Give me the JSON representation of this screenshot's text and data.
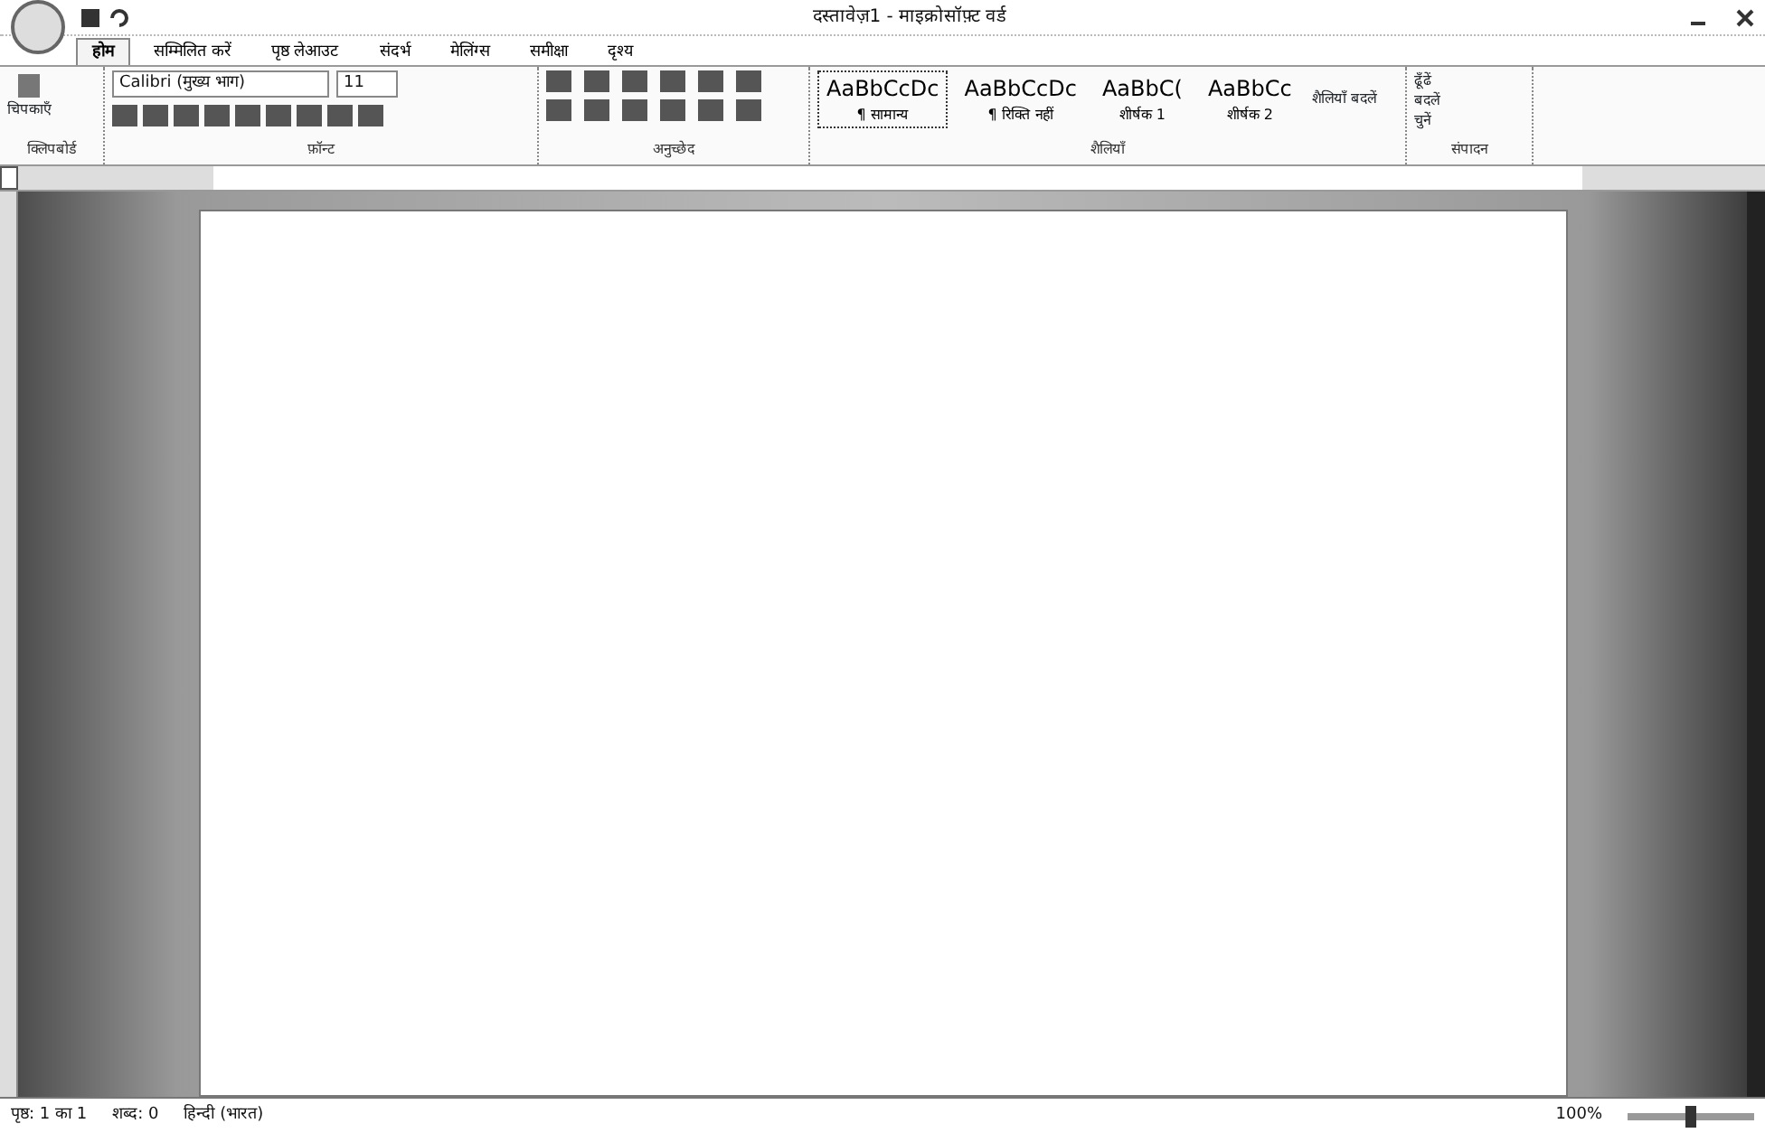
{
  "window": {
    "title": "दस्तावेज़1 - माइक्रोसॉफ़्ट वर्ड"
  },
  "tabs": [
    {
      "label": "होम",
      "selected": true
    },
    {
      "label": "सम्मिलित करें",
      "selected": false
    },
    {
      "label": "पृष्ठ लेआउट",
      "selected": false
    },
    {
      "label": "संदर्भ",
      "selected": false
    },
    {
      "label": "मेलिंग्स",
      "selected": false
    },
    {
      "label": "समीक्षा",
      "selected": false
    },
    {
      "label": "दृश्य",
      "selected": false
    }
  ],
  "ribbon": {
    "paste": "चिपकाएँ",
    "font": {
      "name": "Calibri (मुख्य भाग)",
      "size": "11"
    },
    "styles": [
      {
        "sample": "AaBbCcDc",
        "label": "¶ सामान्य",
        "selected": true
      },
      {
        "sample": "AaBbCcDc",
        "label": "¶ रिक्ति नहीं",
        "selected": false
      },
      {
        "sample": "AaBbC(",
        "label": "शीर्षक 1",
        "selected": false
      },
      {
        "sample": "AaBbCc",
        "label": "शीर्षक 2",
        "selected": false
      }
    ],
    "change_styles": "शैलियाँ बदलें",
    "editing": [
      "ढूँढें",
      "बदलें",
      "चुनें"
    ],
    "groups": [
      "क्लिपबोर्ड",
      "फ़ॉन्ट",
      "अनुच्छेद",
      "शैलियाँ",
      "संपादन"
    ]
  },
  "status_bar": {
    "page": "पृष्ठ: 1 का 1",
    "words": "शब्द: 0",
    "language": "हिन्दी (भारत)",
    "zoom": "100%",
    "level": 0.5
  }
}
